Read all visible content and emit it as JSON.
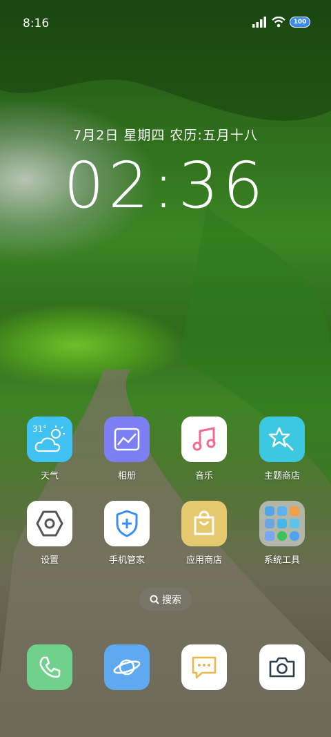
{
  "status_bar": {
    "time": "8:16",
    "battery": "100"
  },
  "lock_info": {
    "date_line": "7月2日  星期四  农历:五月十八",
    "clock": "02:36"
  },
  "apps": [
    {
      "label": "天气",
      "icon": "weather-icon",
      "temp": "31°"
    },
    {
      "label": "相册",
      "icon": "gallery-icon"
    },
    {
      "label": "音乐",
      "icon": "music-icon"
    },
    {
      "label": "主题商店",
      "icon": "theme-store-icon"
    },
    {
      "label": "设置",
      "icon": "settings-icon"
    },
    {
      "label": "手机管家",
      "icon": "phone-manager-icon"
    },
    {
      "label": "应用商店",
      "icon": "app-store-icon"
    },
    {
      "label": "系统工具",
      "icon": "system-tools-folder-icon"
    }
  ],
  "search": {
    "label": "搜索"
  },
  "dock": [
    {
      "icon": "phone-icon"
    },
    {
      "icon": "browser-icon"
    },
    {
      "icon": "messages-icon"
    },
    {
      "icon": "camera-icon"
    }
  ],
  "colors": {
    "weather": "#3fc1f1",
    "gallery": "#7b7ff2",
    "music": "#ffffff",
    "theme": "#3cc8e0",
    "settings": "#ffffff",
    "manager": "#ffffff",
    "appstore": "#e5c96e",
    "phone": "#6fd18c",
    "browser": "#5ea9f0",
    "messages": "#ffffff",
    "camera": "#ffffff"
  }
}
